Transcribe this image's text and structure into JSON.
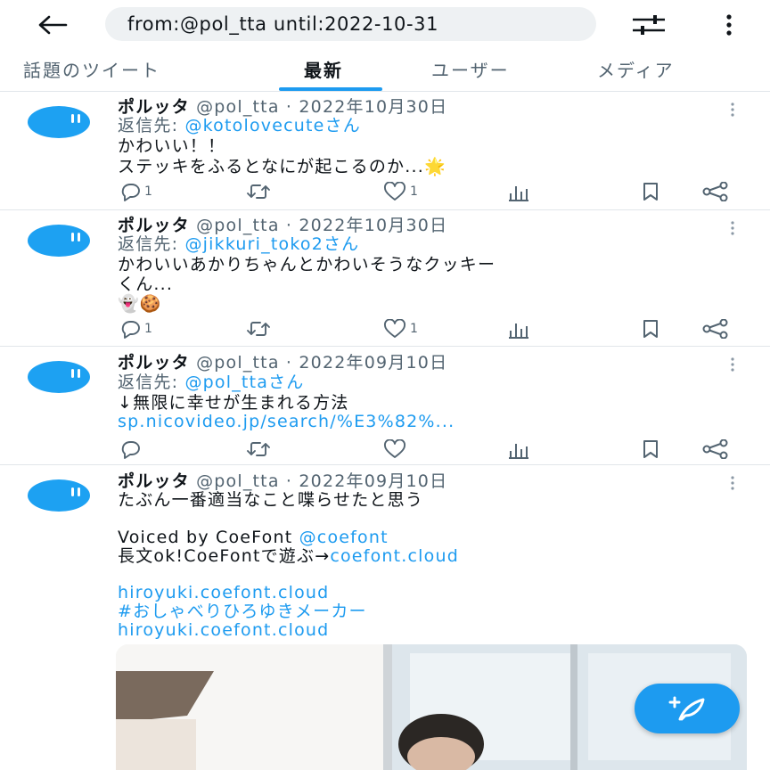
{
  "search": {
    "query": "from:@pol_tta until:2022-10-31"
  },
  "tabs": [
    {
      "label": "話題のツイート",
      "active": false
    },
    {
      "label": "最新",
      "active": true
    },
    {
      "label": "ユーザー",
      "active": false
    },
    {
      "label": "メディア",
      "active": false
    }
  ],
  "tweets": [
    {
      "name": "ポルッタ",
      "meta": "@pol_tta · 2022年10月30日",
      "reply_prefix": "返信先: ",
      "reply_to": "@kotolovecuteさん",
      "lines": [
        "かわいい！！",
        "ステッキをふるとなにが起こるのか..."
      ],
      "emoji": "🌟",
      "replies": "1",
      "retweets": "",
      "likes": "1"
    },
    {
      "name": "ポルッタ",
      "meta": "@pol_tta · 2022年10月30日",
      "reply_prefix": "返信先: ",
      "reply_to": "@jikkuri_toko2さん",
      "lines": [
        "かわいいあかりちゃんとかわいそうなクッキー",
        "くん..."
      ],
      "emoji": "👻🍪",
      "replies": "1",
      "retweets": "",
      "likes": "1"
    },
    {
      "name": "ポルッタ",
      "meta": "@pol_tta · 2022年09月10日",
      "reply_prefix": "返信先: ",
      "reply_to": "@pol_ttaさん",
      "lines": [
        "↓無限に幸せが生まれる方法"
      ],
      "link": "sp.nicovideo.jp/search/%E3%82%...",
      "replies": "",
      "retweets": "",
      "likes": ""
    },
    {
      "name": "ポルッタ",
      "meta": "@pol_tta · 2022年09月10日",
      "line1": "たぶん一番適当なこと喋らせたと思う",
      "line2_text": "Voiced by CoeFont ",
      "line2_link": "@coefont",
      "line3_text": "長文ok!CoeFontで遊ぶ→",
      "line3_link": "coefont.cloud",
      "link1": "hiroyuki.coefont.cloud",
      "hashtag": "#おしゃべりひろゆきメーカー",
      "link2": "hiroyuki.coefont.cloud"
    }
  ],
  "colors": {
    "accent": "#1d9bf0",
    "text": "#0f1419",
    "secondary": "#536471",
    "avatar": "#1da1f2"
  }
}
